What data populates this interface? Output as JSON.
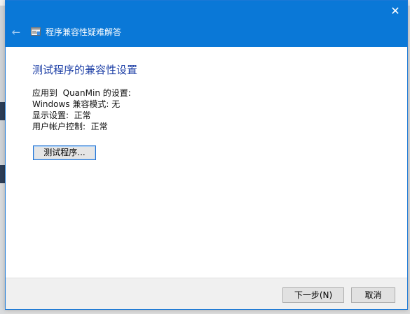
{
  "window": {
    "title": "程序兼容性疑难解答",
    "close_glyph": "✕",
    "back_glyph": "←",
    "icons": {
      "app": "troubleshooter-icon",
      "close": "close-icon",
      "back": "back-arrow-icon"
    },
    "colors": {
      "titlebar": "#0a78d7",
      "heading": "#1d3fa6"
    }
  },
  "main": {
    "heading": "测试程序的兼容性设置",
    "settings_lines": [
      "应用到  QuanMin 的设置:",
      "Windows 兼容模式: 无",
      "显示设置:  正常",
      "用户帐户控制:  正常"
    ],
    "test_button_label": "测试程序..."
  },
  "footer": {
    "next_label": "下一步(N)",
    "cancel_label": "取消"
  }
}
